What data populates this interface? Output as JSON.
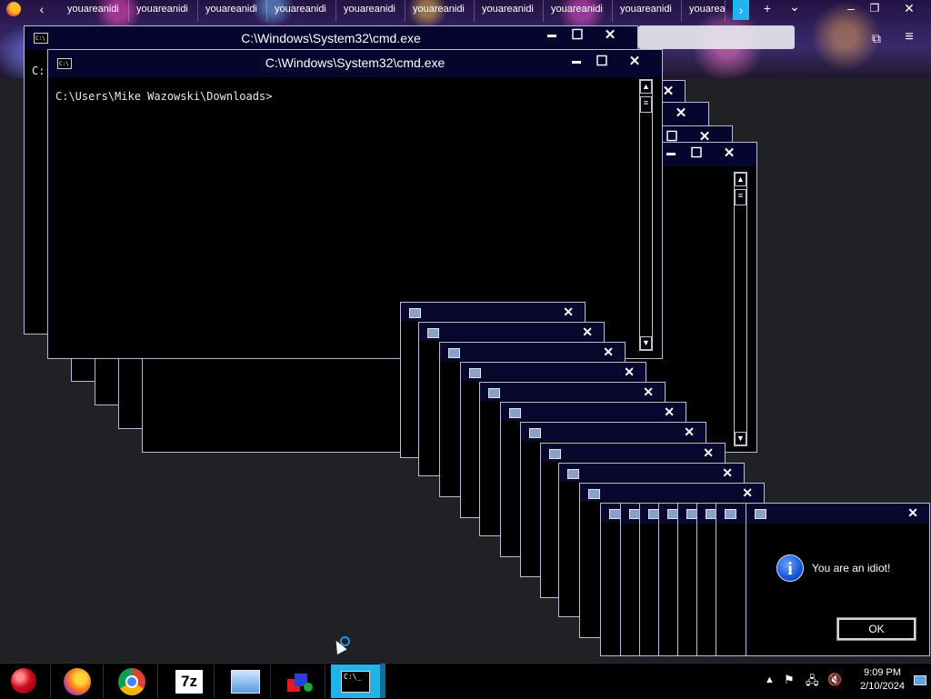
{
  "browser": {
    "tabs": [
      "youareanidi",
      "youareanidi",
      "youareanidi",
      "youareanidi",
      "youareanidi",
      "youareanidi",
      "youareanidi",
      "youareanidi",
      "youareanidi",
      "youarea"
    ],
    "back_icon": "chevron-left-icon",
    "new_tab": "+",
    "tab_list": "⌄",
    "minimize": "–",
    "maximize": "❐",
    "close": "✕"
  },
  "cmd_back": {
    "title": "C:\\Windows\\System32\\cmd.exe",
    "prompt_fragment": "C:"
  },
  "cmd_front": {
    "title": "C:\\Windows\\System32\\cmd.exe",
    "prompt": "C:\\Users\\Mike Wazowski\\Downloads>",
    "icon_text": "C:\\"
  },
  "controls": {
    "minimize": "▬",
    "maximize": "☐",
    "close": "✕"
  },
  "message_box": {
    "text": "You are an idiot!",
    "ok_label": "OK",
    "icon": "information-icon"
  },
  "taskbar": {
    "apps": [
      {
        "name": "ornament-app",
        "icon": "christmas-ornament-icon"
      },
      {
        "name": "firefox",
        "icon": "firefox-icon"
      },
      {
        "name": "chrome",
        "icon": "chrome-icon"
      },
      {
        "name": "7zip",
        "label": "7z",
        "icon": "7zip-icon"
      },
      {
        "name": "control-panel",
        "icon": "control-panel-icon"
      },
      {
        "name": "paint-app",
        "icon": "paint-shapes-icon"
      },
      {
        "name": "cmd",
        "label": "C:\\_",
        "icon": "cmd-icon"
      }
    ],
    "clock_time": "9:09 PM",
    "clock_date": "2/10/2024",
    "colors": {
      "active_task": "#1fb3e8",
      "bar": "#000000"
    }
  }
}
